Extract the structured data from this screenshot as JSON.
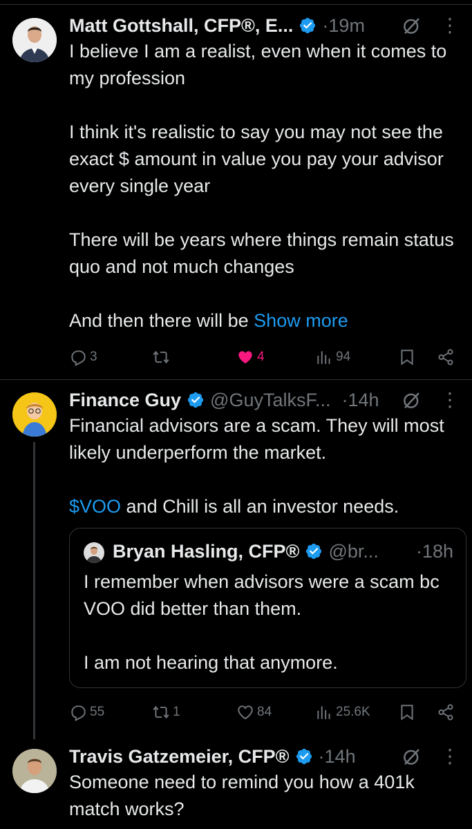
{
  "posts": [
    {
      "name": "Matt Gottshall, CFP®, E...",
      "time": "·19m",
      "paragraphs": [
        "I believe I am a realist, even when it comes to my profession",
        "I think it's realistic to say you may not see the exact $ amount in value you pay your advisor every single year",
        "There will be years where things remain status quo and not much changes"
      ],
      "last_text": "And then there will be ",
      "show_more": "Show more",
      "replies": "3",
      "reposts": "",
      "likes": "4",
      "views": "94"
    },
    {
      "name": "Finance Guy",
      "handle": "@GuyTalksF...",
      "time": "·14h",
      "para1": "Financial advisors are a scam. They will most likely underperform the market.",
      "cashtag": "$VOO",
      "para2_rest": " and Chill is all an investor needs.",
      "quote": {
        "name": "Bryan Hasling, CFP®",
        "handle": "@br...",
        "time": "·18h",
        "para1": "I remember when advisors were a scam bc VOO did better than them.",
        "para2": "I am not hearing that anymore."
      },
      "replies": "55",
      "reposts": "1",
      "likes": "84",
      "views": "25.6K"
    },
    {
      "name": "Travis Gatzemeier, CFP®",
      "time": "·14h",
      "text": "Someone need to remind you how a 401k match works?"
    }
  ],
  "icons": {
    "verified": "verified-badge-icon",
    "grok": "grok-icon",
    "more": "more-icon",
    "reply": "reply-icon",
    "repost": "repost-icon",
    "like": "like-icon",
    "views": "views-icon",
    "bookmark": "bookmark-icon",
    "share": "share-icon"
  },
  "colors": {
    "background": "#000000",
    "text": "#e7e9ea",
    "muted": "#71767b",
    "link": "#1d9bf0",
    "like": "#f91880",
    "verified": "#1d9bf0"
  }
}
